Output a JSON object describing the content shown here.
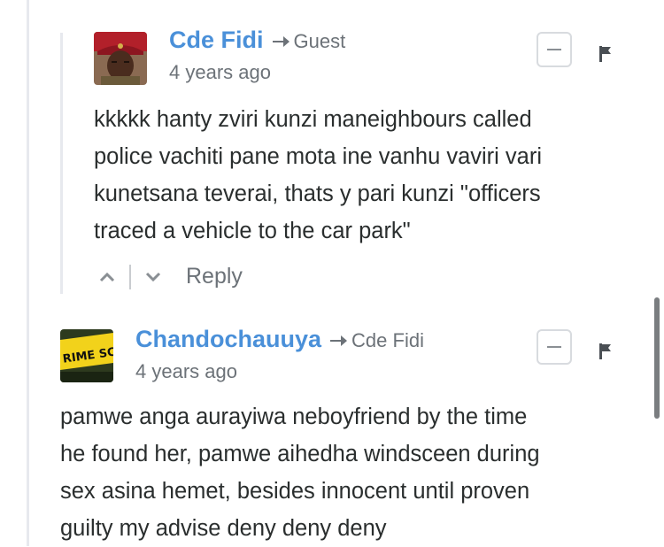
{
  "comments": [
    {
      "author": "Cde Fidi",
      "reply_to": "Guest",
      "time": "4 years ago",
      "lines": [
        "kkkkk hanty zviri kunzi maneighbours called",
        "police vachiti pane mota ine vanhu vaviri vari",
        "kunetsana teverai, thats y pari kunzi \"officers",
        "traced a vehicle to the car park\""
      ],
      "reply_label": "Reply"
    },
    {
      "author": "Chandochauuya",
      "reply_to": "Cde Fidi",
      "time": "4 years ago",
      "lines": [
        "pamwe anga aurayiwa neboyfriend by the time",
        "he found her, pamwe aihedha windsceen during",
        "sex asina hemet, besides innocent until proven",
        "guilty my advise deny deny deny"
      ],
      "avatar_text": "RIME SCENE"
    }
  ],
  "colors": {
    "author": "#4a90d9",
    "meta": "#6c7278",
    "text": "#2a2e2e"
  }
}
